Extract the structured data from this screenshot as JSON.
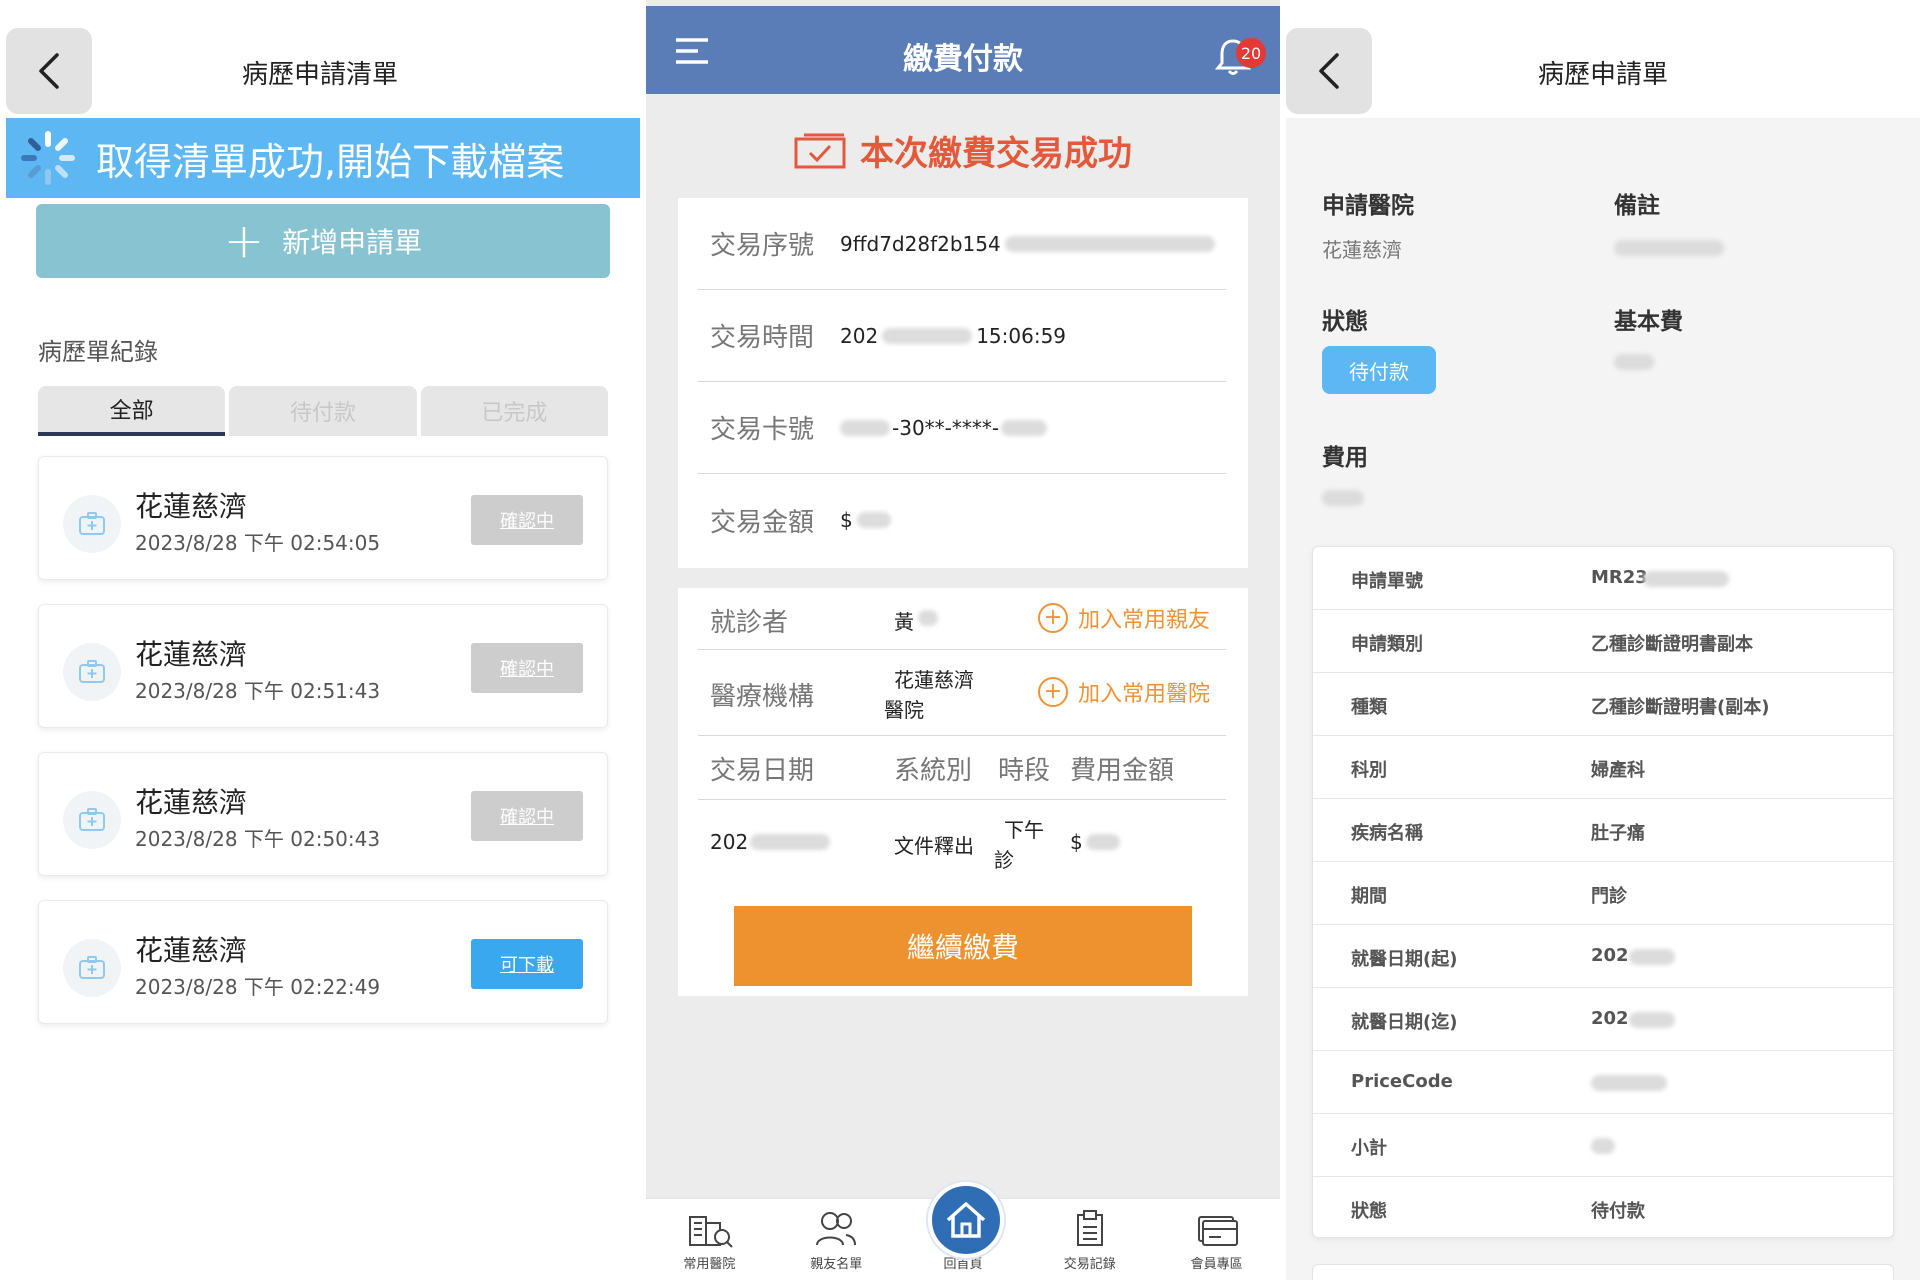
{
  "p1": {
    "title": "病歷申請清單",
    "toast": "取得清單成功,開始下載檔案",
    "add_button": "新增申請單",
    "section_label": "病歷單紀錄",
    "tabs": [
      "全部",
      "待付款",
      "已完成"
    ],
    "records": [
      {
        "hospital": "花蓮慈濟",
        "time": "2023/8/28 下午 02:54:05",
        "status": "確認中",
        "status_type": "gray"
      },
      {
        "hospital": "花蓮慈濟",
        "time": "2023/8/28 下午 02:51:43",
        "status": "確認中",
        "status_type": "gray"
      },
      {
        "hospital": "花蓮慈濟",
        "time": "2023/8/28 下午 02:50:43",
        "status": "確認中",
        "status_type": "gray"
      },
      {
        "hospital": "花蓮慈濟",
        "time": "2023/8/28 下午 02:22:49",
        "status": "可下載",
        "status_type": "blue"
      }
    ]
  },
  "p2": {
    "title": "繳費付款",
    "notification_count": "20",
    "success_text": "本次繳費交易成功",
    "tx": {
      "serial_label": "交易序號",
      "serial_value": "9ffd7d28f2b154",
      "time_label": "交易時間",
      "time_prefix": "202",
      "time_suffix": "15:06:59",
      "card_label": "交易卡號",
      "card_value": "-30**-****-",
      "amount_label": "交易金額",
      "amount_value": "$"
    },
    "patient_label": "就診者",
    "patient_value": "黃",
    "add_relative": "加入常用親友",
    "institution_label": "醫療機構",
    "institution_line1": "花蓮慈濟",
    "institution_line2": "醫院",
    "add_hospital": "加入常用醫院",
    "table_headers": {
      "date": "交易日期",
      "system": "系統別",
      "period": "時段",
      "amount": "費用金額"
    },
    "table_row": {
      "date": "202",
      "system": "文件釋出",
      "period_line1": "下午",
      "period_line2": "診",
      "amount": "$"
    },
    "continue_button": "繼續繳費",
    "nav": [
      "常用醫院",
      "親友名單",
      "回首頁",
      "交易記錄",
      "會員專區"
    ],
    "colors": {
      "header": "#5a7cb7",
      "success": "#e4593a",
      "continue": "#ee922f",
      "home": "#2f6db5"
    }
  },
  "p3": {
    "title": "病歷申請單",
    "hospital_label": "申請醫院",
    "hospital_value": "花蓮慈濟",
    "note_label": "備註",
    "status_label": "狀態",
    "status_value": "待付款",
    "basic_fee_label": "基本費",
    "fee_label": "費用",
    "details": [
      {
        "k": "申請單號",
        "v": "MR23"
      },
      {
        "k": "申請類別",
        "v": "乙種診斷證明書副本"
      },
      {
        "k": "種類",
        "v": "乙種診斷證明書(副本)"
      },
      {
        "k": "科別",
        "v": "婦產科"
      },
      {
        "k": "疾病名稱",
        "v": "肚子痛"
      },
      {
        "k": "期間",
        "v": "門診"
      },
      {
        "k": "就醫日期(起)",
        "v": "202"
      },
      {
        "k": "就醫日期(迄)",
        "v": "202"
      },
      {
        "k": "PriceCode",
        "v": ""
      },
      {
        "k": "小計",
        "v": ""
      },
      {
        "k": "狀態",
        "v": "待付款"
      }
    ]
  }
}
